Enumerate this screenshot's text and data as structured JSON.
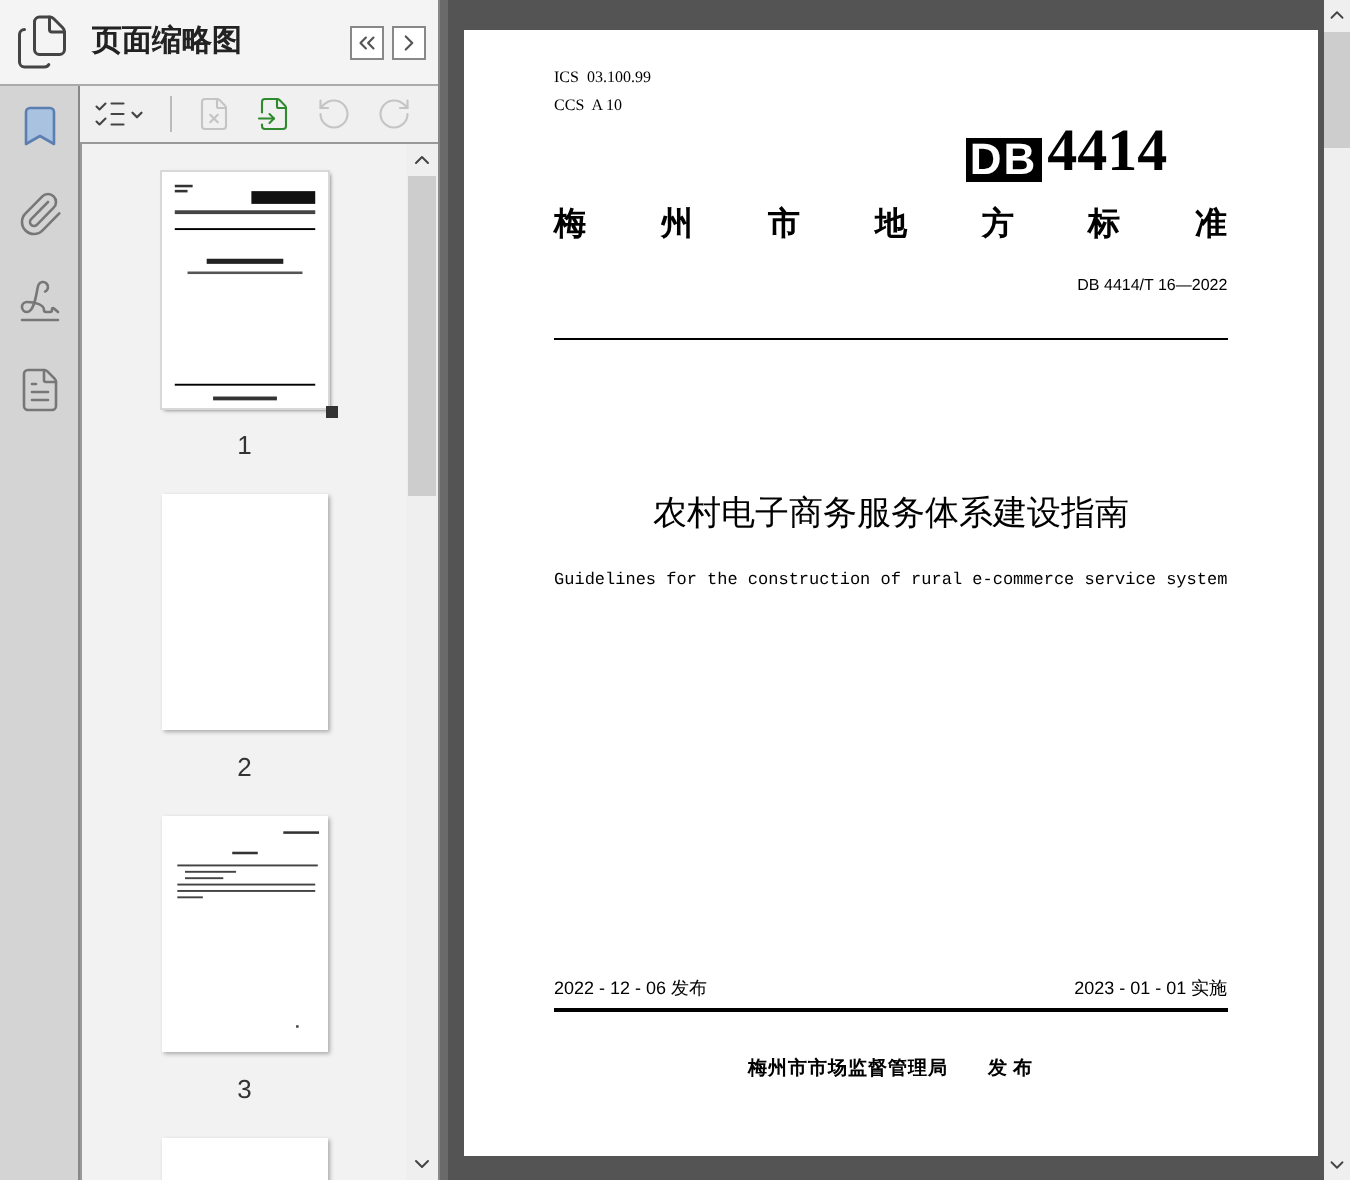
{
  "sidebar": {
    "title": "页面缩略图",
    "rail": [
      {
        "kind": "bookmark",
        "selected": true
      },
      {
        "kind": "attachment",
        "selected": false
      },
      {
        "kind": "signature",
        "selected": false
      },
      {
        "kind": "pages",
        "selected": false
      }
    ],
    "toolbar": [
      {
        "kind": "options",
        "disabled": false
      },
      {
        "kind": "delete",
        "disabled": true
      },
      {
        "kind": "insert",
        "disabled": false
      },
      {
        "kind": "rotate-left",
        "disabled": true
      },
      {
        "kind": "rotate-right",
        "disabled": true
      }
    ],
    "thumbnails": [
      {
        "kind": "cover",
        "label": "1",
        "selected": true
      },
      {
        "kind": "blank",
        "label": "2",
        "selected": false
      },
      {
        "kind": "text",
        "label": "3",
        "selected": false
      },
      {
        "kind": "blank",
        "selected": false
      }
    ]
  },
  "document": {
    "ics": "ICS  03.100.99",
    "ccs": "CCS  A 10",
    "logo_mark": "DB",
    "logo_number": "4414",
    "category": "梅州市地方标准",
    "code": "DB 4414/T 16—2022",
    "title": "农村电子商务服务体系建设指南",
    "subtitle": "Guidelines for the construction of rural e-commerce service system",
    "issued": "2022 - 12 - 06 发布",
    "effective": "2023 - 01 - 01 实施",
    "publisher": "梅州市市场监督管理局",
    "publish_word": "发 布"
  }
}
